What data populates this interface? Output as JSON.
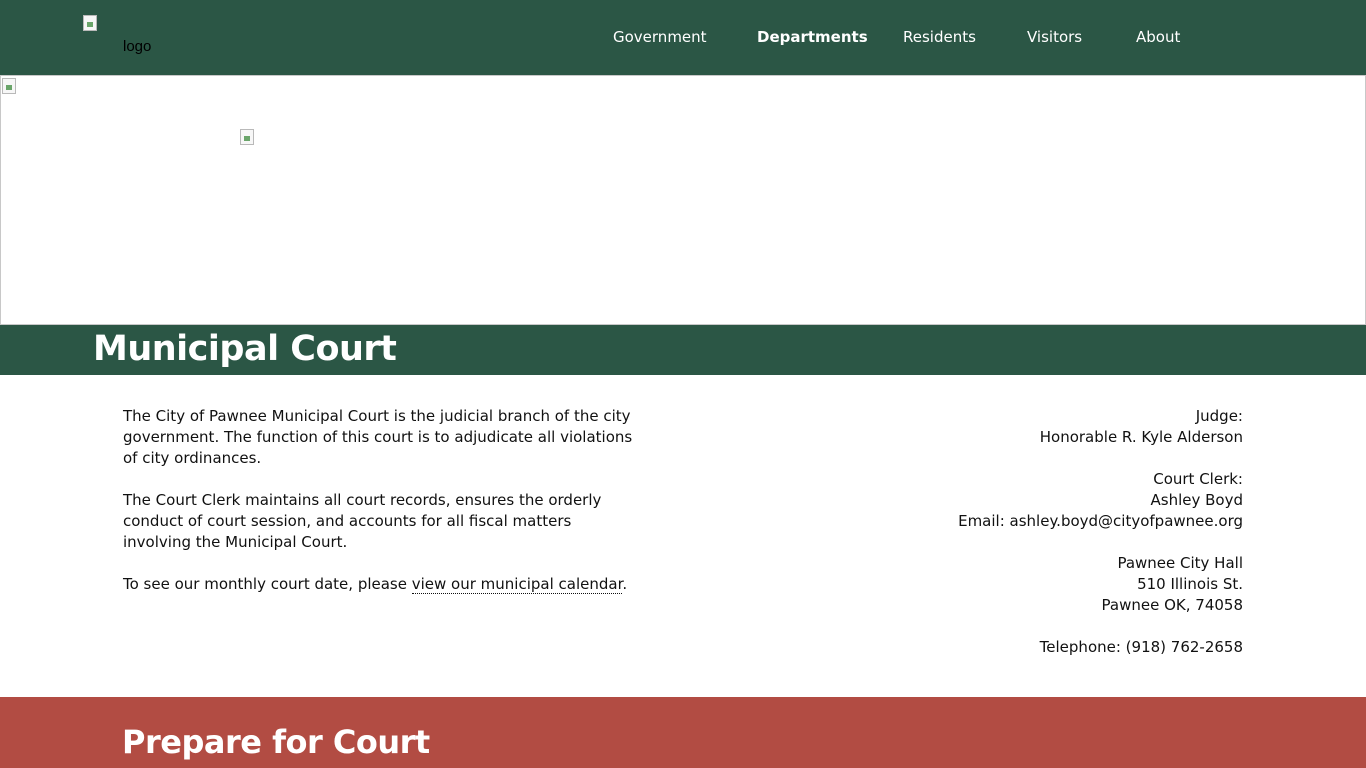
{
  "header": {
    "logo_alt": "logo",
    "nav": [
      {
        "label": "Government",
        "active": false
      },
      {
        "label": "Departments",
        "active": true
      },
      {
        "label": "Residents",
        "active": false
      },
      {
        "label": "Visitors",
        "active": false
      },
      {
        "label": "About",
        "active": false
      }
    ]
  },
  "page": {
    "title": "Municipal Court"
  },
  "intro": {
    "paragraph1": "The City of Pawnee Municipal Court is the judicial branch of the city government. The function of this court is to adjudicate all violations of city ordinances.",
    "paragraph2": "The Court Clerk maintains all court records, ensures the orderly conduct of court session, and accounts for all fiscal matters involving the Municipal Court.",
    "calendar_prefix": "To see our monthly court date, please ",
    "calendar_link": "view our municipal calendar",
    "calendar_suffix": "."
  },
  "contact": {
    "judge_label": "Judge:",
    "judge_name": "Honorable R. Kyle Alderson",
    "clerk_label": "Court Clerk:",
    "clerk_name": "Ashley Boyd",
    "clerk_email": "Email: ashley.boyd@cityofpawnee.org",
    "address_line1": "Pawnee City Hall",
    "address_line2": "510 Illinois St.",
    "address_line3": "Pawnee OK, 74058",
    "telephone": "Telephone: (918) 762-2658"
  },
  "prepare": {
    "title": "Prepare for Court"
  },
  "colors": {
    "brand_green": "#2b5645",
    "accent_red": "#b24c43",
    "nav_text": "#ffffff"
  }
}
